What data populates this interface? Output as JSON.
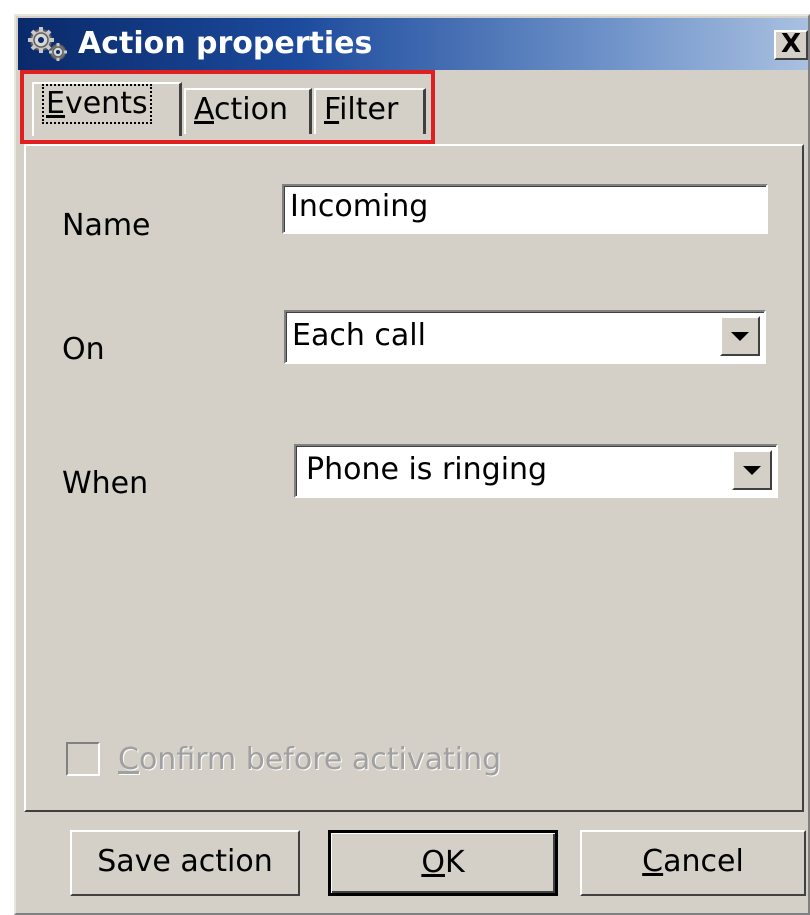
{
  "window": {
    "title": "Action properties",
    "close_symbol": "X",
    "icon": "gears-icon"
  },
  "tabs": [
    {
      "label_first": "E",
      "label_rest": "vents",
      "active": true
    },
    {
      "label_first": "A",
      "label_rest": "ction",
      "active": false
    },
    {
      "label_first": "F",
      "label_rest": "ilter",
      "active": false
    }
  ],
  "highlight_color": "#e02020",
  "form": {
    "name_label": "Name",
    "name_value": "Incoming",
    "on_label": "On",
    "on_value": "Each call",
    "when_label": "When",
    "when_value": "Phone is ringing",
    "confirm_first": "C",
    "confirm_rest": "onfirm before activating",
    "confirm_checked": false,
    "confirm_enabled": false
  },
  "buttons": {
    "save_label": "Save action",
    "ok_first": "O",
    "ok_rest": "K",
    "cancel_first": "C",
    "cancel_rest": "ancel"
  }
}
